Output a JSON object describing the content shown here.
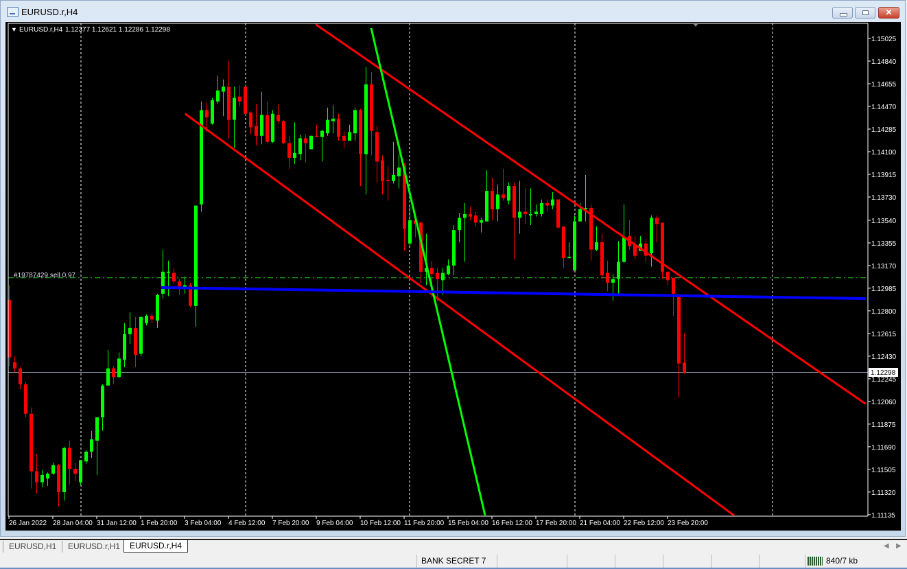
{
  "window": {
    "title": "EURUSD.r,H4",
    "close_glyph": "✕"
  },
  "chart_header": {
    "symbol": "EURUSD.r,H4",
    "ohlc": "1.12377 1.12621 1.12286 1.12298"
  },
  "order_label": "#19787429 sell 0.97",
  "current_price_label": "1.12298",
  "colors": {
    "bull": "#00ff00",
    "bear": "#ff0000",
    "trend_red": "#ff0000",
    "trend_green": "#00ff00",
    "level_blue": "#0000ff",
    "order_line": "#22cc22",
    "bid_line": "#8899aa",
    "grid": "#ffffff"
  },
  "chart_data": {
    "type": "candlestick",
    "symbol": "EURUSD.r",
    "timeframe": "H4",
    "ylim": [
      1.11135,
      1.1512
    ],
    "y_ticks": [
      "1.15025",
      "1.14840",
      "1.14655",
      "1.14470",
      "1.14285",
      "1.14100",
      "1.13915",
      "1.13730",
      "1.13540",
      "1.13355",
      "1.13170",
      "1.12985",
      "1.12800",
      "1.12615",
      "1.12430",
      "1.12245",
      "1.12060",
      "1.11875",
      "1.11690",
      "1.11505",
      "1.11320",
      "1.11135"
    ],
    "x_labels": [
      "26 Jan 2022",
      "28 Jan 04:00",
      "31 Jan 12:00",
      "1 Feb 20:00",
      "3 Feb 04:00",
      "4 Feb 12:00",
      "7 Feb 20:00",
      "9 Feb 04:00",
      "10 Feb 12:00",
      "11 Feb 20:00",
      "15 Feb 04:00",
      "16 Feb 12:00",
      "17 Feb 20:00",
      "21 Feb 04:00",
      "22 Feb 12:00",
      "23 Feb 20:00"
    ],
    "x_label_every_bars": 8,
    "ohlc": [
      [
        1.1289,
        1.1301,
        1.1235,
        1.1242
      ],
      [
        1.1238,
        1.1243,
        1.123,
        1.1233
      ],
      [
        1.1233,
        1.1234,
        1.1216,
        1.122
      ],
      [
        1.122,
        1.1222,
        1.1193,
        1.1196
      ],
      [
        1.1196,
        1.1201,
        1.1135,
        1.1149
      ],
      [
        1.1149,
        1.1163,
        1.1131,
        1.114
      ],
      [
        1.114,
        1.115,
        1.1136,
        1.1146
      ],
      [
        1.1143,
        1.1148,
        1.1137,
        1.1147
      ],
      [
        1.1147,
        1.1156,
        1.1146,
        1.1154
      ],
      [
        1.1154,
        1.1155,
        1.112,
        1.1132
      ],
      [
        1.1132,
        1.1169,
        1.1125,
        1.1168
      ],
      [
        1.1168,
        1.1174,
        1.1138,
        1.1151
      ],
      [
        1.1151,
        1.1156,
        1.1141,
        1.1147
      ],
      [
        1.114,
        1.1158,
        1.1138,
        1.1158
      ],
      [
        1.1157,
        1.1166,
        1.1155,
        1.1165
      ],
      [
        1.1165,
        1.1182,
        1.116,
        1.1175
      ],
      [
        1.1174,
        1.1193,
        1.1146,
        1.1193
      ],
      [
        1.1193,
        1.122,
        1.1182,
        1.1219
      ],
      [
        1.1219,
        1.1248,
        1.1219,
        1.1233
      ],
      [
        1.1233,
        1.1235,
        1.122,
        1.1226
      ],
      [
        1.1226,
        1.1246,
        1.1225,
        1.1241
      ],
      [
        1.124,
        1.127,
        1.1234,
        1.1261
      ],
      [
        1.1261,
        1.1279,
        1.1253,
        1.1266
      ],
      [
        1.1266,
        1.1275,
        1.1234,
        1.1244
      ],
      [
        1.1245,
        1.1275,
        1.1243,
        1.1275
      ],
      [
        1.127,
        1.1277,
        1.1268,
        1.1276
      ],
      [
        1.1276,
        1.1278,
        1.127,
        1.1273
      ],
      [
        1.1272,
        1.1294,
        1.1266,
        1.1293
      ],
      [
        1.1294,
        1.133,
        1.129,
        1.1312
      ],
      [
        1.1311,
        1.1321,
        1.1292,
        1.1312
      ],
      [
        1.1311,
        1.1315,
        1.1302,
        1.1304
      ],
      [
        1.1304,
        1.1306,
        1.1293,
        1.13
      ],
      [
        1.1299,
        1.1308,
        1.1294,
        1.1301
      ],
      [
        1.1301,
        1.1303,
        1.1283,
        1.1284
      ],
      [
        1.1284,
        1.1366,
        1.1267,
        1.1366
      ],
      [
        1.1367,
        1.1451,
        1.1361,
        1.1444
      ],
      [
        1.1444,
        1.145,
        1.1426,
        1.1438
      ],
      [
        1.1433,
        1.1454,
        1.1432,
        1.1452
      ],
      [
        1.1451,
        1.1472,
        1.1449,
        1.146
      ],
      [
        1.1459,
        1.1469,
        1.1439,
        1.1463
      ],
      [
        1.1463,
        1.1484,
        1.1421,
        1.1436
      ],
      [
        1.1436,
        1.1463,
        1.1413,
        1.1454
      ],
      [
        1.1455,
        1.1464,
        1.1447,
        1.1451
      ],
      [
        1.1463,
        1.1465,
        1.1439,
        1.1441
      ],
      [
        1.1442,
        1.1443,
        1.1424,
        1.143
      ],
      [
        1.1431,
        1.1449,
        1.1415,
        1.1423
      ],
      [
        1.1423,
        1.1459,
        1.1416,
        1.144
      ],
      [
        1.144,
        1.1451,
        1.1417,
        1.1418
      ],
      [
        1.1418,
        1.1444,
        1.1417,
        1.1441
      ],
      [
        1.144,
        1.1449,
        1.1433,
        1.1435
      ],
      [
        1.1435,
        1.1436,
        1.1416,
        1.1417
      ],
      [
        1.1417,
        1.1423,
        1.1396,
        1.1405
      ],
      [
        1.1405,
        1.1434,
        1.14,
        1.1409
      ],
      [
        1.1408,
        1.1424,
        1.1403,
        1.1421
      ],
      [
        1.1421,
        1.1424,
        1.1401,
        1.1417
      ],
      [
        1.1412,
        1.1423,
        1.1412,
        1.1423
      ],
      [
        1.1423,
        1.1432,
        1.1422,
        1.1422
      ],
      [
        1.1422,
        1.1428,
        1.1402,
        1.1427
      ],
      [
        1.1425,
        1.1446,
        1.1423,
        1.1436
      ],
      [
        1.1435,
        1.1448,
        1.1425,
        1.1437
      ],
      [
        1.1437,
        1.1441,
        1.1419,
        1.1422
      ],
      [
        1.1423,
        1.1427,
        1.1413,
        1.1419
      ],
      [
        1.1419,
        1.1432,
        1.1419,
        1.1426
      ],
      [
        1.1425,
        1.1446,
        1.1419,
        1.1444
      ],
      [
        1.1444,
        1.1445,
        1.1382,
        1.1408
      ],
      [
        1.1408,
        1.1479,
        1.1375,
        1.1465
      ],
      [
        1.1465,
        1.1475,
        1.1407,
        1.1427
      ],
      [
        1.1426,
        1.1431,
        1.1385,
        1.1402
      ],
      [
        1.1403,
        1.1407,
        1.1375,
        1.1386
      ],
      [
        1.1387,
        1.1398,
        1.137,
        1.1386
      ],
      [
        1.1386,
        1.1418,
        1.1384,
        1.1391
      ],
      [
        1.139,
        1.1408,
        1.138,
        1.1397
      ],
      [
        1.1399,
        1.1401,
        1.1329,
        1.1347
      ],
      [
        1.1335,
        1.1366,
        1.1332,
        1.1354
      ],
      [
        1.1354,
        1.1356,
        1.134,
        1.1351
      ],
      [
        1.1352,
        1.1353,
        1.1303,
        1.1312
      ],
      [
        1.1312,
        1.1343,
        1.1301,
        1.1315
      ],
      [
        1.1315,
        1.1321,
        1.1291,
        1.131
      ],
      [
        1.1311,
        1.1315,
        1.1288,
        1.1306
      ],
      [
        1.1305,
        1.1315,
        1.1293,
        1.1311
      ],
      [
        1.131,
        1.1322,
        1.1309,
        1.1317
      ],
      [
        1.1317,
        1.135,
        1.1309,
        1.1346
      ],
      [
        1.1346,
        1.136,
        1.1336,
        1.1356
      ],
      [
        1.1356,
        1.1368,
        1.132,
        1.1359
      ],
      [
        1.1359,
        1.1365,
        1.1354,
        1.1357
      ],
      [
        1.1358,
        1.1361,
        1.1349,
        1.1352
      ],
      [
        1.1352,
        1.1356,
        1.1344,
        1.1354
      ],
      [
        1.1353,
        1.1395,
        1.1353,
        1.1378
      ],
      [
        1.1378,
        1.1389,
        1.1354,
        1.1363
      ],
      [
        1.1363,
        1.1383,
        1.1353,
        1.1375
      ],
      [
        1.1375,
        1.1396,
        1.137,
        1.1372
      ],
      [
        1.137,
        1.1385,
        1.1367,
        1.1382
      ],
      [
        1.1382,
        1.1385,
        1.1322,
        1.1356
      ],
      [
        1.1356,
        1.1386,
        1.1343,
        1.1361
      ],
      [
        1.1361,
        1.138,
        1.1351,
        1.1359
      ],
      [
        1.1358,
        1.138,
        1.135,
        1.1359
      ],
      [
        1.1359,
        1.1367,
        1.1357,
        1.1361
      ],
      [
        1.1359,
        1.1371,
        1.1357,
        1.1368
      ],
      [
        1.1368,
        1.1371,
        1.1361,
        1.1366
      ],
      [
        1.1366,
        1.1377,
        1.1363,
        1.1371
      ],
      [
        1.1371,
        1.1371,
        1.1347,
        1.1348
      ],
      [
        1.1349,
        1.1349,
        1.1315,
        1.1323
      ],
      [
        1.1323,
        1.1336,
        1.1323,
        1.1324
      ],
      [
        1.1313,
        1.1358,
        1.1313,
        1.1353
      ],
      [
        1.1353,
        1.1368,
        1.1353,
        1.1363
      ],
      [
        1.1363,
        1.1391,
        1.1353,
        1.1364
      ],
      [
        1.1364,
        1.1367,
        1.1321,
        1.133
      ],
      [
        1.133,
        1.1349,
        1.1329,
        1.1336
      ],
      [
        1.1336,
        1.1343,
        1.1306,
        1.1309
      ],
      [
        1.1311,
        1.1321,
        1.1296,
        1.1303
      ],
      [
        1.1303,
        1.131,
        1.1288,
        1.1306
      ],
      [
        1.1306,
        1.1337,
        1.1292,
        1.132
      ],
      [
        1.132,
        1.1367,
        1.1319,
        1.134
      ],
      [
        1.1341,
        1.1354,
        1.133,
        1.1333
      ],
      [
        1.1334,
        1.1341,
        1.1322,
        1.1325
      ],
      [
        1.1329,
        1.1341,
        1.1329,
        1.1335
      ],
      [
        1.1335,
        1.1339,
        1.132,
        1.1325
      ],
      [
        1.1327,
        1.1358,
        1.1316,
        1.1356
      ],
      [
        1.1356,
        1.1358,
        1.1336,
        1.1351
      ],
      [
        1.1352,
        1.1352,
        1.1306,
        1.1312
      ],
      [
        1.1312,
        1.1312,
        1.1301,
        1.1305
      ],
      [
        1.1307,
        1.1307,
        1.1276,
        1.1294
      ],
      [
        1.1292,
        1.1292,
        1.1209,
        1.1237
      ],
      [
        1.12377,
        1.12621,
        1.12286,
        1.12298
      ]
    ],
    "trendlines": [
      {
        "name": "upper-channel-line",
        "color": "#ff0000",
        "from": [
          55.9,
          1.1514
        ],
        "to": [
          156.1,
          1.1204
        ]
      },
      {
        "name": "lower-channel-line",
        "color": "#ff0000",
        "from": [
          32.1,
          1.1441
        ],
        "to": [
          132.1,
          1.1113
        ]
      },
      {
        "name": "steep-green-trendline",
        "color": "#00ff00",
        "from": [
          66.0,
          1.1511
        ],
        "to": [
          86.75,
          1.1113
        ]
      },
      {
        "name": "blue-support-line",
        "color": "#0000ff",
        "from": [
          27.75,
          1.1299
        ],
        "to": [
          156.1,
          1.129
        ]
      }
    ],
    "order_level": 1.1307,
    "bid": 1.12298
  },
  "tabs": [
    {
      "label": "EURUSD,H1",
      "active": false
    },
    {
      "label": "EURUSD.r,H1",
      "active": false
    },
    {
      "label": "EURUSD.r,H4",
      "active": true
    }
  ],
  "status": {
    "profile": "BANK SECRET 7",
    "traffic": "840/7 kb"
  }
}
